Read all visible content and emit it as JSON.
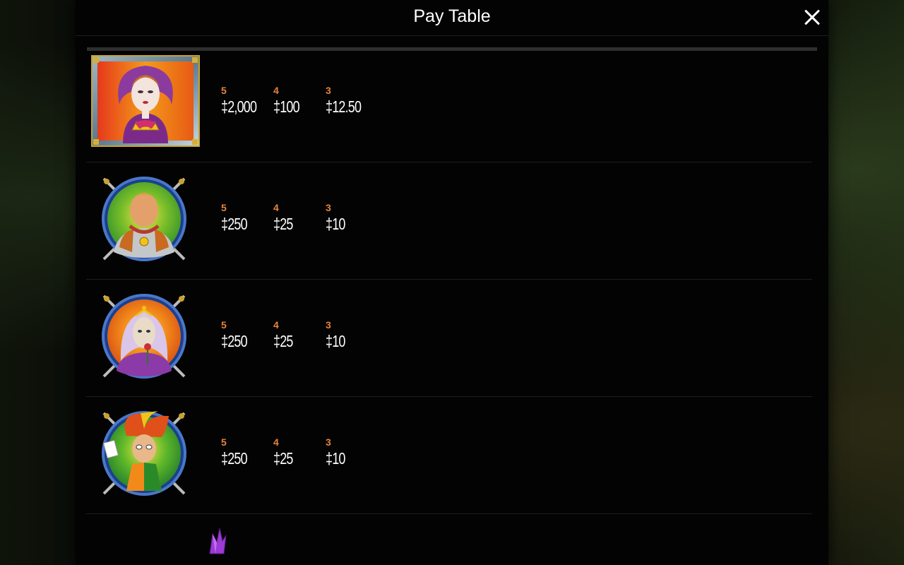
{
  "window": {
    "title": "Pay Table",
    "close_icon": "close-icon"
  },
  "accent": "#e7843a",
  "paytable": [
    {
      "symbol": "queen-card-icon",
      "pays": [
        {
          "count": "5",
          "amount": "‡2,000"
        },
        {
          "count": "4",
          "amount": "‡100"
        },
        {
          "count": "3",
          "amount": "‡12.50"
        }
      ]
    },
    {
      "symbol": "knight-shield-icon",
      "pays": [
        {
          "count": "5",
          "amount": "‡250"
        },
        {
          "count": "4",
          "amount": "‡25"
        },
        {
          "count": "3",
          "amount": "‡10"
        }
      ]
    },
    {
      "symbol": "lady-shield-icon",
      "pays": [
        {
          "count": "5",
          "amount": "‡250"
        },
        {
          "count": "4",
          "amount": "‡25"
        },
        {
          "count": "3",
          "amount": "‡10"
        }
      ]
    },
    {
      "symbol": "jester-shield-icon",
      "pays": [
        {
          "count": "5",
          "amount": "‡250"
        },
        {
          "count": "4",
          "amount": "‡25"
        },
        {
          "count": "3",
          "amount": "‡10"
        }
      ]
    }
  ]
}
